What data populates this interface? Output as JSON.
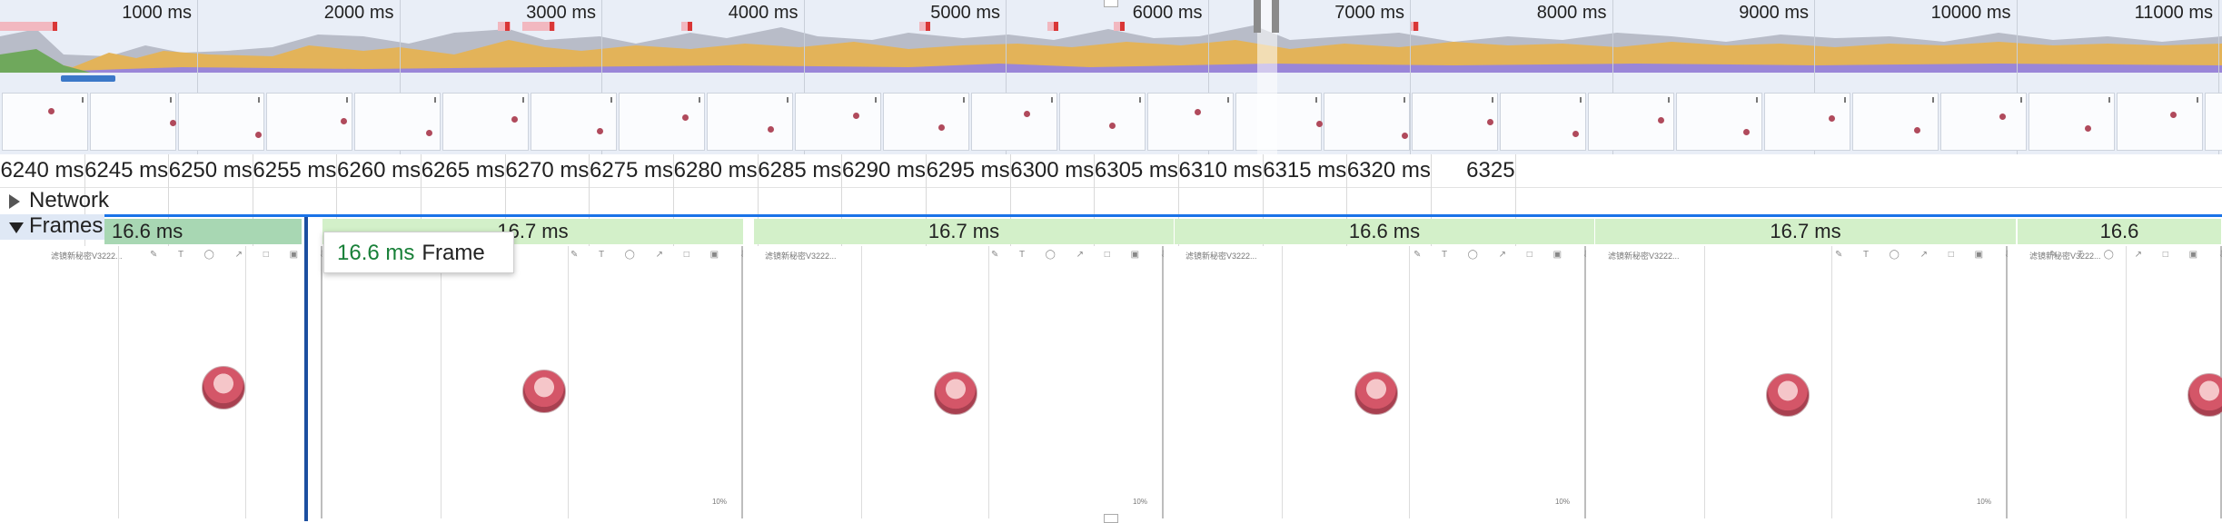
{
  "overview": {
    "time_labels": [
      "1000 ms",
      "2000 ms",
      "3000 ms",
      "4000 ms",
      "5000 ms",
      "6000 ms",
      "7000 ms",
      "8000 ms",
      "9000 ms",
      "10000 ms",
      "11000 ms"
    ]
  },
  "ruler": {
    "labels": [
      "6240 ms",
      "6245 ms",
      "6250 ms",
      "6255 ms",
      "6260 ms",
      "6265 ms",
      "6270 ms",
      "6275 ms",
      "6280 ms",
      "6285 ms",
      "6290 ms",
      "6295 ms",
      "6300 ms",
      "6305 ms",
      "6310 ms",
      "6315 ms",
      "6320 ms",
      "6325"
    ]
  },
  "tracks": {
    "network_label": "Network",
    "frames_label": "Frames"
  },
  "frames": {
    "durations": [
      "16.6 ms",
      "16.7 ms",
      "16.7 ms",
      "16.6 ms",
      "16.7 ms",
      "16.6"
    ]
  },
  "screenshots": {
    "title": "滤镜新秘密V3222...",
    "tool_glyphs": "✎ T ◯ ↗ □ ▣ ⇩",
    "zoom": "10%"
  },
  "tooltip": {
    "duration": "16.6 ms",
    "label": "Frame"
  },
  "colors": {
    "selection_line": "#1c4fa0",
    "frame_green": "#d3f0c9",
    "frame_selected": "#a8d7b3",
    "duration_text": "#188038"
  }
}
